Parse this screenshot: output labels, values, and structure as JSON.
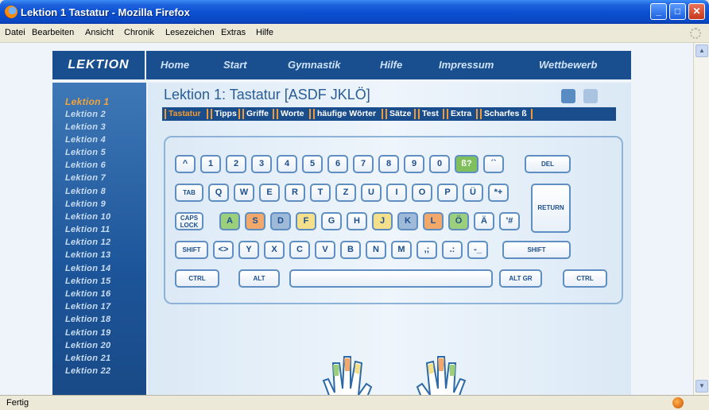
{
  "window": {
    "title": "Lektion 1 Tastatur - Mozilla Firefox",
    "controls": {
      "minimize": "_",
      "maximize": "□",
      "close": "✕"
    }
  },
  "menu": [
    "Datei",
    "Bearbeiten",
    "Ansicht",
    "Chronik",
    "Lesezeichen",
    "Extras",
    "Hilfe"
  ],
  "site_nav": {
    "brand": "LEKTION",
    "items": [
      "Home",
      "Start",
      "Gymnastik",
      "Hilfe",
      "Impressum",
      "Wettbewerb"
    ]
  },
  "lessons": [
    "Lektion 1",
    "Lektion 2",
    "Lektion 3",
    "Lektion 4",
    "Lektion 5",
    "Lektion 6",
    "Lektion 7",
    "Lektion 8",
    "Lektion 9",
    "Lektion 10",
    "Lektion 11",
    "Lektion 12",
    "Lektion 13",
    "Lektion 14",
    "Lektion 15",
    "Lektion 16",
    "Lektion 17",
    "Lektion 18",
    "Lektion 19",
    "Lektion 20",
    "Lektion 21",
    "Lektion 22"
  ],
  "page": {
    "title": "Lektion 1: Tastatur [ASDF JKLÖ]",
    "tabs": [
      "Tastatur",
      "Tipps",
      "Griffe",
      "Worte",
      "häufige Wörter",
      "Sätze",
      "Test",
      "Extra",
      "Scharfes ß"
    ],
    "active_tab": "Tastatur"
  },
  "keyboard": {
    "row1": [
      "^",
      "1",
      "2",
      "3",
      "4",
      "5",
      "6",
      "7",
      "8",
      "9",
      "0",
      "ß?",
      "´`",
      "DEL"
    ],
    "row2": [
      "TAB",
      "Q",
      "W",
      "E",
      "R",
      "T",
      "Z",
      "U",
      "I",
      "O",
      "P",
      "Ü",
      "*+",
      "RETURN"
    ],
    "row3": [
      "CAPS LOCK",
      "A",
      "S",
      "D",
      "F",
      "G",
      "H",
      "J",
      "K",
      "L",
      "Ö",
      "Ä",
      "'#"
    ],
    "row4": [
      "SHIFT",
      "<>",
      "Y",
      "X",
      "C",
      "V",
      "B",
      "N",
      "M",
      ",;",
      ".:",
      "-_",
      "SHIFT"
    ],
    "row5": [
      "CTRL",
      "ALT",
      "",
      "ALT GR",
      "CTRL"
    ]
  },
  "colors": {
    "nav_bg": "#194e8f",
    "active_orange": "#f19a33",
    "finger_green": "#9ccf7b",
    "finger_orange": "#f1a86a",
    "finger_blue": "#9fb9d8",
    "finger_yellow": "#f4e08a"
  },
  "status": "Fertig"
}
